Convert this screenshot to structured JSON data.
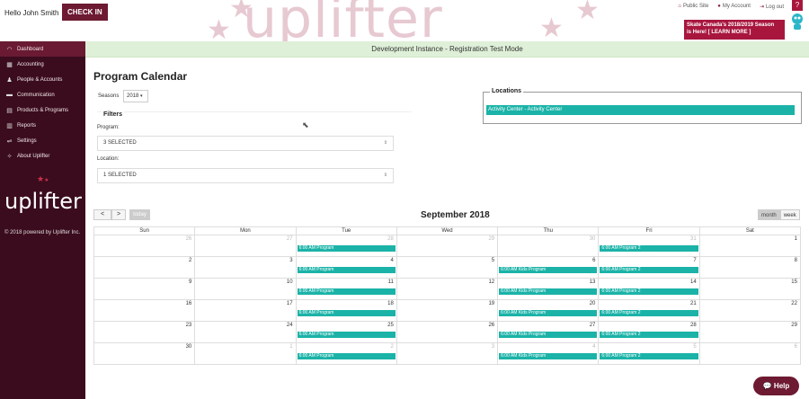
{
  "header": {
    "greeting": "Hello John Smith",
    "checkin_label": "CHECK IN",
    "watermark": "uplifter",
    "links": [
      {
        "icon": "home-icon",
        "label": "Public Site"
      },
      {
        "icon": "user-icon",
        "label": "My Account"
      },
      {
        "icon": "logout-icon",
        "label": "Log out"
      }
    ],
    "banner_line1": "Skate Canada's 2018/2019 Season",
    "banner_line2": "is Here! [ LEARN MORE ]",
    "help_q": "?"
  },
  "sidebar": {
    "items": [
      {
        "icon": "dashboard-icon",
        "glyph": "◠",
        "label": "Dashboard",
        "active": true
      },
      {
        "icon": "accounting-icon",
        "glyph": "▦",
        "label": "Accounting"
      },
      {
        "icon": "people-icon",
        "glyph": "♟",
        "label": "People & Accounts"
      },
      {
        "icon": "communication-icon",
        "glyph": "▬",
        "label": "Communication"
      },
      {
        "icon": "products-icon",
        "glyph": "▤",
        "label": "Products & Programs"
      },
      {
        "icon": "reports-icon",
        "glyph": "▥",
        "label": "Reports"
      },
      {
        "icon": "settings-icon",
        "glyph": "⇌",
        "label": "Settings"
      },
      {
        "icon": "about-icon",
        "glyph": "✧",
        "label": "About Uplifter"
      }
    ],
    "logo": "uplifter",
    "powered": "© 2018 powered by Uplifter Inc."
  },
  "devbar": "Development Instance - Registration Test Mode",
  "main": {
    "title": "Program Calendar",
    "seasons_label": "Seasons",
    "seasons_value": "2018",
    "filters_label": "Filters",
    "program_label": "Program:",
    "program_value": "3 SELECTED",
    "location_label": "Location:",
    "location_value": "1 SELECTED",
    "locations_label": "Locations",
    "location_item": "Activity Center - Activity Center"
  },
  "calendar": {
    "prev": "<",
    "next": ">",
    "today": "today",
    "title": "September 2018",
    "views": [
      "month",
      "week"
    ],
    "weekdays": [
      "Sun",
      "Mon",
      "Tue",
      "Wed",
      "Thu",
      "Fri",
      "Sat"
    ],
    "weeks": [
      [
        {
          "d": "26",
          "o": true
        },
        {
          "d": "27",
          "o": true
        },
        {
          "d": "28",
          "o": true,
          "ev": "6:00 AM Program"
        },
        {
          "d": "29",
          "o": true
        },
        {
          "d": "30",
          "o": true
        },
        {
          "d": "31",
          "o": true,
          "ev": "6:00 AM Program 2"
        },
        {
          "d": "1"
        }
      ],
      [
        {
          "d": "2"
        },
        {
          "d": "3"
        },
        {
          "d": "4",
          "ev": "6:00 AM Program"
        },
        {
          "d": "5"
        },
        {
          "d": "6",
          "ev": "6:00 AM Kids Program"
        },
        {
          "d": "7",
          "ev": "6:00 AM Program 2"
        },
        {
          "d": "8"
        }
      ],
      [
        {
          "d": "9"
        },
        {
          "d": "10"
        },
        {
          "d": "11",
          "ev": "6:00 AM Program"
        },
        {
          "d": "12"
        },
        {
          "d": "13",
          "ev": "6:00 AM Kids Program"
        },
        {
          "d": "14",
          "ev": "6:00 AM Program 2"
        },
        {
          "d": "15"
        }
      ],
      [
        {
          "d": "16"
        },
        {
          "d": "17"
        },
        {
          "d": "18",
          "ev": "6:00 AM Program"
        },
        {
          "d": "19"
        },
        {
          "d": "20",
          "ev": "6:00 AM Kids Program"
        },
        {
          "d": "21",
          "ev": "6:00 AM Program 2"
        },
        {
          "d": "22"
        }
      ],
      [
        {
          "d": "23"
        },
        {
          "d": "24"
        },
        {
          "d": "25",
          "ev": "6:00 AM Program"
        },
        {
          "d": "26"
        },
        {
          "d": "27",
          "ev": "6:00 AM Kids Program"
        },
        {
          "d": "28",
          "ev": "6:00 AM Program 2"
        },
        {
          "d": "29"
        }
      ],
      [
        {
          "d": "30"
        },
        {
          "d": "1",
          "o": true
        },
        {
          "d": "2",
          "o": true,
          "ev": "6:00 AM Program"
        },
        {
          "d": "3",
          "o": true
        },
        {
          "d": "4",
          "o": true,
          "ev": "6:00 AM Kids Program"
        },
        {
          "d": "5",
          "o": true,
          "ev": "6:00 AM Program 2"
        },
        {
          "d": "6",
          "o": true
        }
      ]
    ]
  },
  "help_label": "Help",
  "colors": {
    "brand": "#6d1a32",
    "sidebar": "#3b0c1d",
    "event": "#1bb3a8",
    "banner": "#a8163e"
  }
}
